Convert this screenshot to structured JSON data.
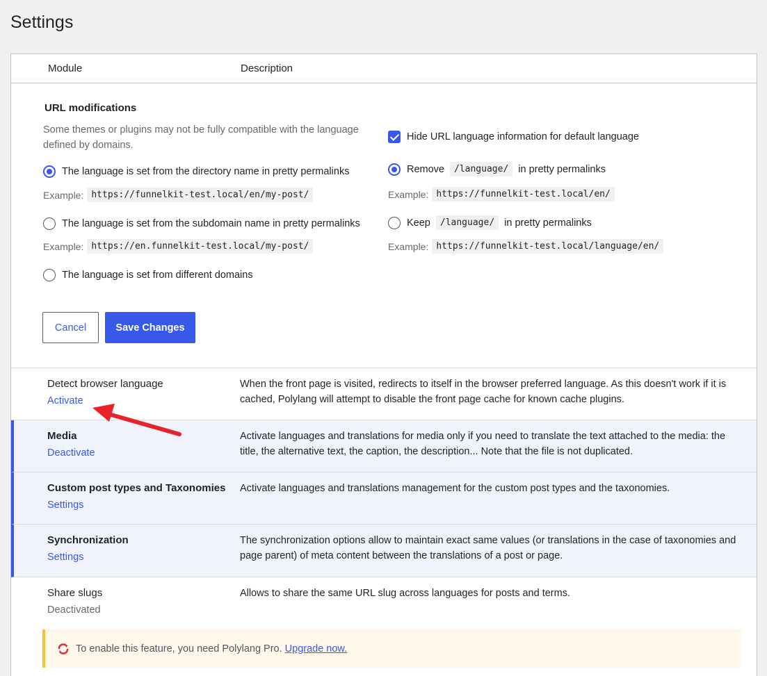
{
  "page": {
    "title": "Settings"
  },
  "table": {
    "col_module": "Module",
    "col_description": "Description"
  },
  "url_modifications": {
    "heading": "URL modifications",
    "note": "Some themes or plugins may not be fully compatible with the language defined by domains.",
    "example_label": "Example:",
    "options_left": [
      {
        "label": "The language is set from the directory name in pretty permalinks",
        "selected": true,
        "example": "https://funnelkit-test.local/en/my-post/"
      },
      {
        "label": "The language is set from the subdomain name in pretty permalinks",
        "selected": false,
        "example": "https://en.funnelkit-test.local/my-post/"
      },
      {
        "label": "The language is set from different domains",
        "selected": false
      }
    ],
    "hide_default": {
      "label": "Hide URL language information for default language",
      "checked": true
    },
    "remove": {
      "prefix": "Remove",
      "code": "/language/",
      "suffix": "in pretty permalinks",
      "selected": true,
      "example": "https://funnelkit-test.local/en/"
    },
    "keep": {
      "prefix": "Keep",
      "code": "/language/",
      "suffix": "in pretty permalinks",
      "selected": false,
      "example": "https://funnelkit-test.local/language/en/"
    },
    "cancel_label": "Cancel",
    "save_label": "Save Changes"
  },
  "modules": [
    {
      "name": "Detect browser language",
      "action": "Activate",
      "active": false,
      "description": "When the front page is visited, redirects to itself in the browser preferred language. As this doesn't work if it is cached, Polylang will attempt to disable the front page cache for known cache plugins."
    },
    {
      "name": "Media",
      "action": "Deactivate",
      "active": true,
      "description": "Activate languages and translations for media only if you need to translate the text attached to the media: the title, the alternative text, the caption, the description... Note that the file is not duplicated."
    },
    {
      "name": "Custom post types and Taxonomies",
      "action": "Settings",
      "active": true,
      "description": "Activate languages and translations management for the custom post types and the taxonomies."
    },
    {
      "name": "Synchronization",
      "action": "Settings",
      "active": true,
      "description": "The synchronization options allow to maintain exact same values (or translations in the case of taxonomies and page parent) of meta content between the translations of a post or page."
    },
    {
      "name": "Share slugs",
      "action": "Deactivated",
      "active": false,
      "description": "Allows to share the same URL slug across languages for posts and terms."
    }
  ],
  "notice": {
    "text": "To enable this feature, you need Polylang Pro.",
    "link": "Upgrade now."
  },
  "colors": {
    "accent": "#3858e9",
    "notice_border": "#f0c33c",
    "arrow": "#e8222a",
    "sync_icon": "#d63638"
  }
}
